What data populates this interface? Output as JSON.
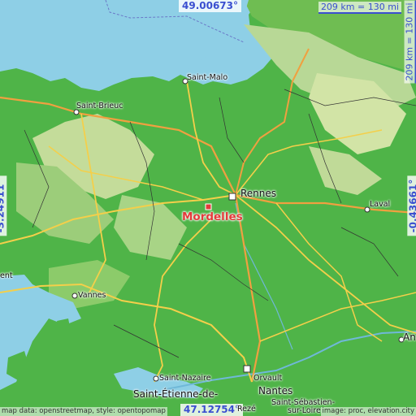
{
  "map": {
    "coords": {
      "top": "49.00673°",
      "bottom": "47.12754°",
      "left": "-3.24911°",
      "right": "-0.43661°"
    },
    "scale": {
      "top": "209 km = 130 mi",
      "right": "209 km = 130 mi"
    },
    "place_label": "Mordelles",
    "cities": {
      "saint_malo": "Saint-Malo",
      "saint_brieuc": "Saint-Brieuc",
      "rennes": "Rennes",
      "laval": "Laval",
      "vannes": "Vannes",
      "ent": "ent",
      "an": "An",
      "saint_nazaire": "Saint-Nazaire",
      "saint_etienne": "Saint-Étienne-de-",
      "orvault": "Orvault",
      "nantes": "Nantes",
      "saint_sebastien": "Saint-Sébastien-",
      "sur_loire": "sur-Loire",
      "reze": "Rezé"
    },
    "attribution_left": "map data: openstreetmap, style: opentopomap",
    "attribution_right": "image: proc, elevation.city",
    "colors": {
      "sea": "#8ecfe6",
      "lowland": "#4fb448",
      "midland": "#8cc86a",
      "upland": "#c4dc9a",
      "road_major": "#f4cf4a",
      "road_motorway": "#f0a040",
      "marker": "#e33a3a",
      "coord_text": "#3a4fd0"
    }
  }
}
